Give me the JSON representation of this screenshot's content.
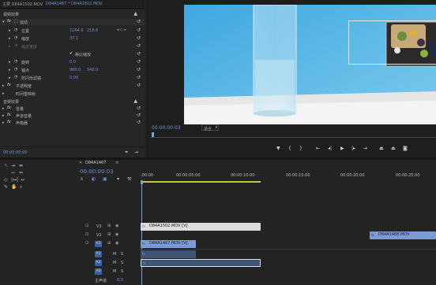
{
  "effect_controls": {
    "tabs": [
      "主要 D84A1502.MOV",
      "D84A1467 * D84A1502.MOV"
    ],
    "video_effects_header": "视频效果",
    "motion_label": "运动",
    "position_label": "位置",
    "position_x": "1164.6",
    "position_y": "218.6",
    "scale_label": "缩放",
    "scale_value": "37.1",
    "scale_width_label": "缩放宽度",
    "uniform_scale_label": "等比缩放",
    "rotation_label": "旋转",
    "rotation_value": "0.0",
    "anchor_label": "锚点",
    "anchor_x": "960.0",
    "anchor_y": "540.0",
    "antiflicker_label": "防闪烁滤镜",
    "antiflicker_value": "0.00",
    "opacity_label": "不透明度",
    "time_remap_label": "时间重映射",
    "audio_effects_header": "音频效果",
    "volume_label": "音量",
    "channel_volume_label": "声道音量",
    "panner_label": "声像器",
    "timecode": "00:00:00:00"
  },
  "program_monitor": {
    "timecode": "00:00:00:03",
    "fit_label": "适合"
  },
  "timeline": {
    "sequence_tab": "D84A1467",
    "timecode": "00:00:00:03",
    "ruler_labels": [
      ":00:00",
      "00:00:05:00",
      "00:00:10:00",
      "00:00:15:00",
      "00:00:20:00",
      "00:00:25:00"
    ],
    "tracks": [
      {
        "name": "V3",
        "kind": "video"
      },
      {
        "name": "V2",
        "kind": "video"
      },
      {
        "name": "V1",
        "kind": "video"
      },
      {
        "name": "A1",
        "kind": "audio"
      },
      {
        "name": "A2",
        "kind": "audio"
      },
      {
        "name": "A3",
        "kind": "audio"
      }
    ],
    "master_label": "主声道",
    "master_value": "0.0",
    "clips": {
      "v3_clip": "D84A1502.MOV [V]",
      "v2_clip": "D84A1468.MOV",
      "v1_clip": "D84A1467.MOV [V]"
    }
  },
  "colors": {
    "accent": "#6f8fd6",
    "video_clip": "#7a9bd4",
    "audio_clip": "#4d8a6a",
    "playhead": "#6fa8e8"
  }
}
